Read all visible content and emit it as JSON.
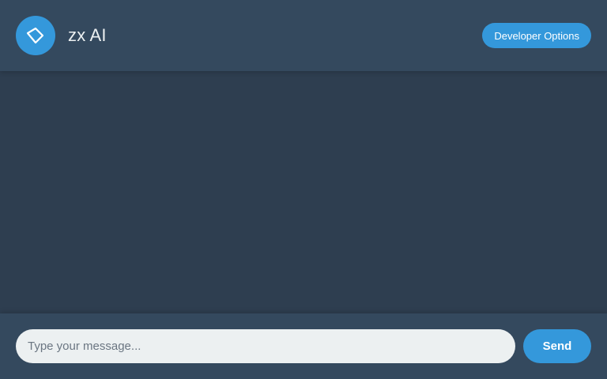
{
  "header": {
    "logo_icon": "tag-diamond-icon",
    "title": "zx AI",
    "developer_options_label": "Developer Options"
  },
  "chat": {
    "messages": []
  },
  "composer": {
    "placeholder": "Type your message...",
    "value": "",
    "send_label": "Send"
  },
  "colors": {
    "accent": "#3498db",
    "header_bg": "#34495e",
    "chat_bg": "#2e3e50",
    "input_bg": "#ecf0f1",
    "text_light": "#ecf0f1"
  }
}
